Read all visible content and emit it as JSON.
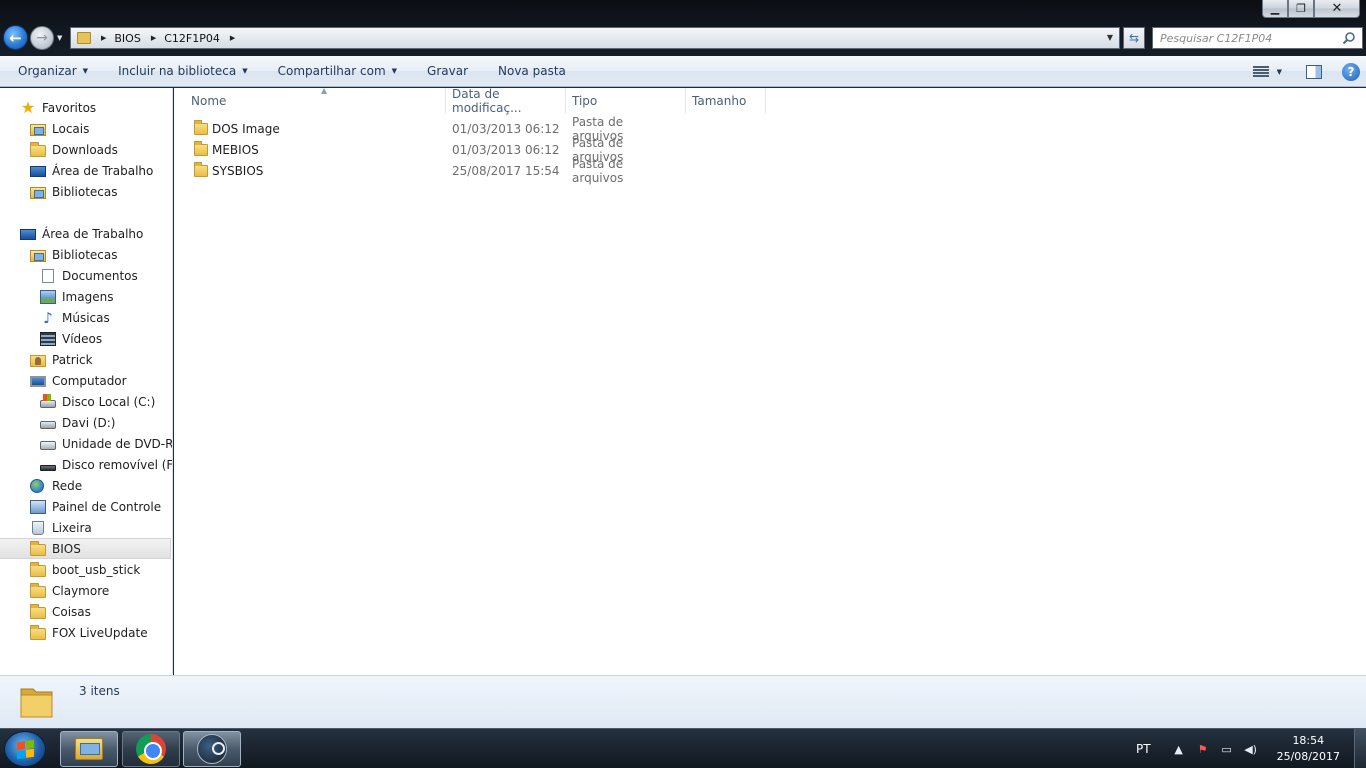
{
  "window": {
    "min_label": "▁",
    "max_label": "❐",
    "close_label": "✕"
  },
  "address_bar": {
    "crumbs": [
      "BIOS",
      "C12F1P04"
    ]
  },
  "search": {
    "placeholder": "Pesquisar C12F1P04"
  },
  "toolbar": {
    "organize": "Organizar",
    "include_library": "Incluir na biblioteca",
    "share": "Compartilhar com",
    "burn": "Gravar",
    "new_folder": "Nova pasta"
  },
  "navpane": {
    "favorites": "Favoritos",
    "fav_items": [
      "Locais",
      "Downloads",
      "Área de Trabalho",
      "Bibliotecas"
    ],
    "desktop": "Área de Trabalho",
    "libraries": "Bibliotecas",
    "lib_items": [
      "Documentos",
      "Imagens",
      "Músicas",
      "Vídeos"
    ],
    "user": "Patrick",
    "computer": "Computador",
    "drives": [
      "Disco Local (C:)",
      "Davi (D:)",
      "Unidade de DVD-RW",
      "Disco removível (F:)"
    ],
    "network": "Rede",
    "control_panel": "Painel de Controle",
    "recycle_bin": "Lixeira",
    "folders": [
      "BIOS",
      "boot_usb_stick",
      "Claymore",
      "Coisas",
      "FOX LiveUpdate"
    ]
  },
  "columns": {
    "name": "Nome",
    "date": "Data de modificaç...",
    "type": "Tipo",
    "size": "Tamanho"
  },
  "files": [
    {
      "name": "DOS Image",
      "date": "01/03/2013 06:12",
      "type": "Pasta de arquivos"
    },
    {
      "name": "MEBIOS",
      "date": "01/03/2013 06:12",
      "type": "Pasta de arquivos"
    },
    {
      "name": "SYSBIOS",
      "date": "25/08/2017 15:54",
      "type": "Pasta de arquivos"
    }
  ],
  "details": {
    "count": "3 itens"
  },
  "taskbar": {
    "language": "PT",
    "time": "18:54",
    "date": "25/08/2017"
  }
}
